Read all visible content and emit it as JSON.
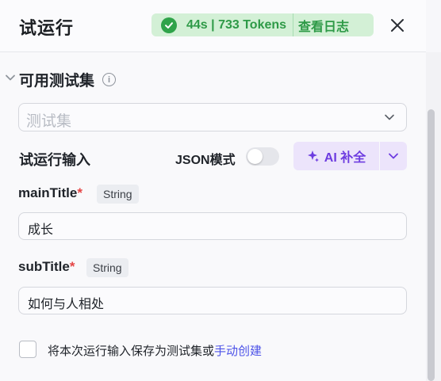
{
  "header": {
    "title": "试运行",
    "status": {
      "duration_tokens": "44s | 733 Tokens",
      "log_label": "查看日志"
    }
  },
  "test_set": {
    "section_label": "可用测试集",
    "select_placeholder": "测试集"
  },
  "run_input": {
    "label": "试运行输入",
    "json_mode_label": "JSON模式",
    "json_mode_on": false,
    "ai_button_label": "AI 补全"
  },
  "fields": [
    {
      "name": "mainTitle",
      "required_mark": "*",
      "type": "String",
      "value": "成长"
    },
    {
      "name": "subTitle",
      "required_mark": "*",
      "type": "String",
      "value": "如何与人相处"
    }
  ],
  "footer": {
    "save_text": "将本次运行输入保存为测试集或",
    "link_text": "手动创建",
    "checked": false
  },
  "colors": {
    "status_bg": "#d3f0d6",
    "status_text": "#2e9a47",
    "ai_accent": "#6d3ce0",
    "link": "#4d53e8",
    "required": "#e54545"
  }
}
